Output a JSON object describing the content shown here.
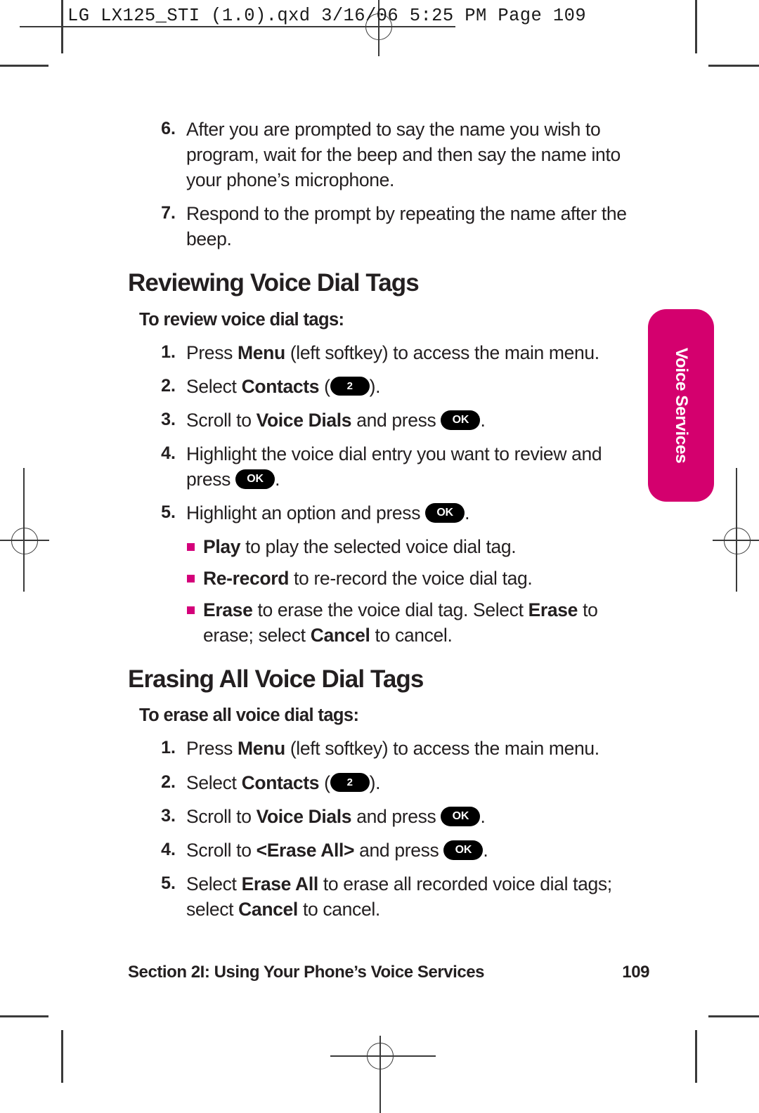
{
  "header": {
    "file_stamp": "LG LX125_STI (1.0).qxd  3/16/06  5:25 PM  Page 109"
  },
  "colors": {
    "tab_magenta": "#d4006e",
    "bullet_magenta": "#d4007a",
    "key_black": "#000000",
    "text": "#231f20"
  },
  "side_tab": {
    "label": "Voice Services"
  },
  "intro_steps": [
    {
      "num": "6.",
      "html": "After you are prompted to say the name you wish to program, wait for the beep and then say the name into your phone’s microphone."
    },
    {
      "num": "7.",
      "html": "Respond to the prompt by repeating the name after the beep."
    }
  ],
  "section_review": {
    "heading": "Reviewing Voice Dial Tags",
    "subheading": "To review voice dial tags:",
    "steps": [
      {
        "num": "1.",
        "html": "Press <b>Menu</b> (left softkey) to access the main menu."
      },
      {
        "num": "2.",
        "html": "Select <b>Contacts</b> (<span class=\"key num2\" data-name=\"key-2-icon\" data-interactable=\"false\">2</span>)."
      },
      {
        "num": "3.",
        "html": "Scroll to <b>Voice Dials</b> and press <span class=\"key ok\" data-name=\"key-ok-icon\" data-interactable=\"false\">OK</span>."
      },
      {
        "num": "4.",
        "html": "Highlight the voice dial entry you want to review and press <span class=\"key ok\" data-name=\"key-ok-icon\" data-interactable=\"false\">OK</span>."
      },
      {
        "num": "5.",
        "html": "Highlight an option and press <span class=\"key ok\" data-name=\"key-ok-icon\" data-interactable=\"false\">OK</span>."
      }
    ],
    "bullets": [
      "<b>Play</b> to play the selected voice dial tag.",
      "<b>Re-record</b> to re-record the voice dial tag.",
      "<b>Erase</b> to erase the voice dial tag. Select <b>Erase</b> to erase; select <b>Cancel</b> to cancel."
    ]
  },
  "section_erase": {
    "heading": "Erasing All Voice Dial Tags",
    "subheading": "To erase all voice dial tags:",
    "steps": [
      {
        "num": "1.",
        "html": "Press <b>Menu</b> (left softkey) to access the main menu."
      },
      {
        "num": "2.",
        "html": "Select <b>Contacts</b> (<span class=\"key num2\" data-name=\"key-2-icon\" data-interactable=\"false\">2</span>)."
      },
      {
        "num": "3.",
        "html": "Scroll to <b>Voice Dials</b> and press <span class=\"key ok\" data-name=\"key-ok-icon\" data-interactable=\"false\">OK</span>."
      },
      {
        "num": "4.",
        "html": "Scroll to <b>&lt;Erase All&gt;</b> and press <span class=\"key ok\" data-name=\"key-ok-icon\" data-interactable=\"false\">OK</span>."
      },
      {
        "num": "5.",
        "html": "Select <b>Erase All</b> to erase all recorded voice dial tags; select <b>Cancel</b> to cancel."
      }
    ]
  },
  "footer": {
    "section_label": "Section 2I: Using Your Phone’s Voice Services",
    "page_number": "109"
  }
}
